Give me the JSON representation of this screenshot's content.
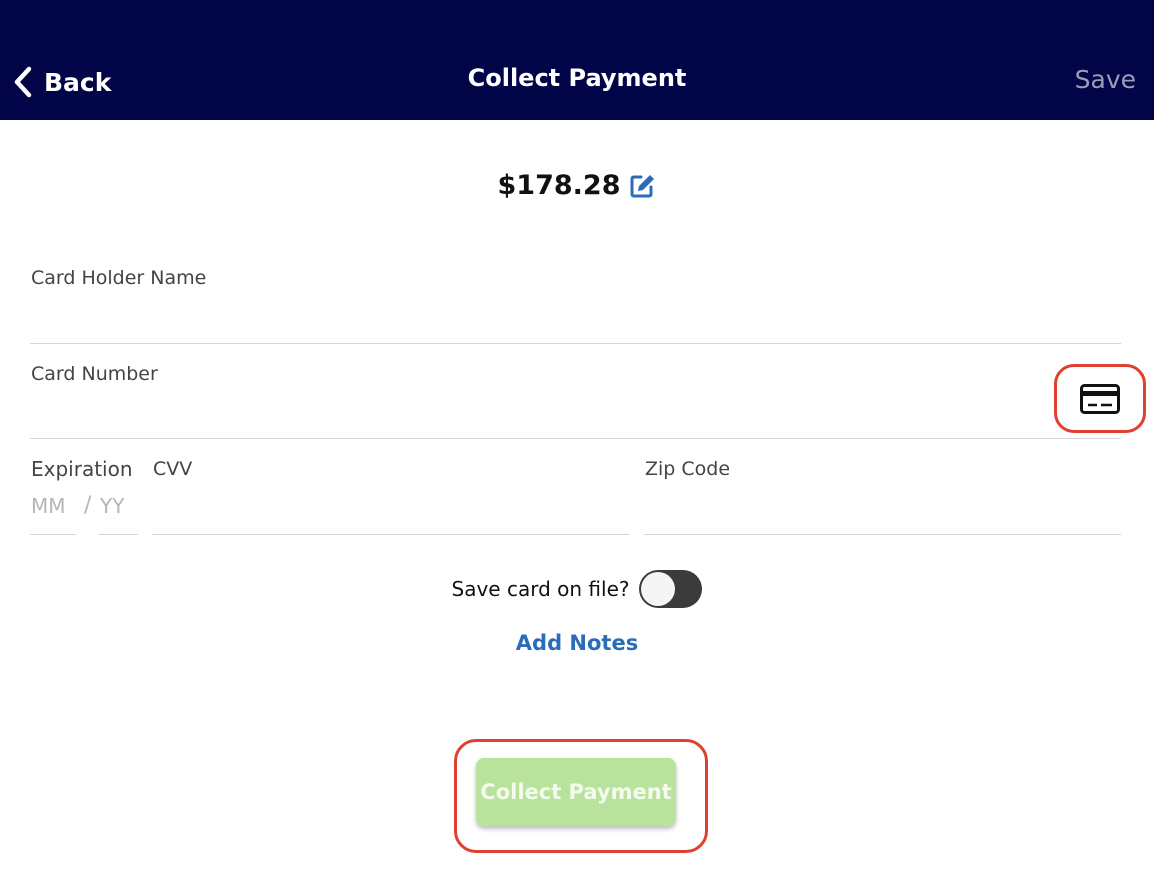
{
  "header": {
    "back_label": "Back",
    "title": "Collect Payment",
    "save_label": "Save"
  },
  "amount": {
    "value": "$178.28"
  },
  "fields": {
    "card_holder_label": "Card Holder Name",
    "card_holder_value": "",
    "card_number_label": "Card Number",
    "card_number_value": "",
    "expiration_label": "Expiration",
    "mm_placeholder": "MM",
    "date_separator": "/",
    "yy_placeholder": "YY",
    "cvv_label": "CVV",
    "cvv_value": "",
    "zip_label": "Zip Code",
    "zip_value": ""
  },
  "save_card": {
    "label": "Save card on file?",
    "enabled": false
  },
  "add_notes_label": "Add Notes",
  "collect_button_label": "Collect Payment",
  "colors": {
    "header_bg": "#010548",
    "accent_blue": "#2b6cb8",
    "collect_button_bg": "#b9e39c",
    "highlight_red": "#e0402f"
  },
  "icons": {
    "back": "chevron-left-icon",
    "edit": "edit-icon",
    "card": "credit-card-icon"
  }
}
